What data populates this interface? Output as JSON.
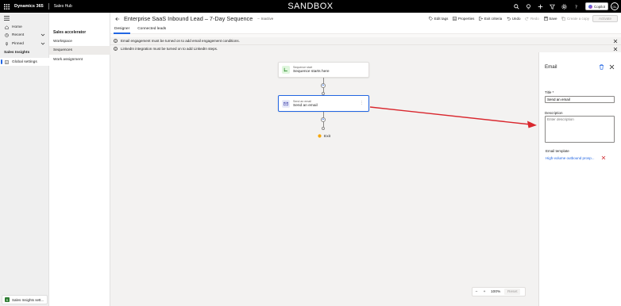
{
  "topbar": {
    "brand": "Dynamics 365",
    "app_name": "Sales Hub",
    "environment_banner": "SANDBOX",
    "copilot_label": "Copilot",
    "avatar_initials": "GL"
  },
  "leftnav": {
    "items": [
      {
        "label": "Home",
        "icon": "home-icon"
      },
      {
        "label": "Recent",
        "icon": "clock-icon"
      },
      {
        "label": "Pinned",
        "icon": "pin-icon"
      }
    ],
    "section_title": "Sales Insights",
    "active_item": "Global settings",
    "area_switcher": {
      "badge": "S",
      "label": "Sales Insights sett..."
    }
  },
  "settings": {
    "title": "Sales accelerator",
    "items": [
      "Workspace",
      "Sequences",
      "Work assignment"
    ],
    "active": "Sequences"
  },
  "header": {
    "title": "Enterprise SaaS Inbound Lead – 7-Day Sequence",
    "status": "Inactive",
    "actions": [
      {
        "label": "Edit tags",
        "icon": "tag-icon",
        "disabled": false
      },
      {
        "label": "Properties",
        "icon": "properties-icon",
        "disabled": false
      },
      {
        "label": "Exit criteria",
        "icon": "exit-icon",
        "disabled": false
      },
      {
        "label": "Undo",
        "icon": "undo-icon",
        "disabled": false
      },
      {
        "label": "Redo",
        "icon": "redo-icon",
        "disabled": true
      },
      {
        "label": "Save",
        "icon": "save-icon",
        "disabled": false
      },
      {
        "label": "Create a copy",
        "icon": "copy-icon",
        "disabled": true
      }
    ],
    "activate_label": "Activate"
  },
  "tabs": [
    {
      "label": "Designer",
      "active": true
    },
    {
      "label": "Connected leads",
      "active": false
    }
  ],
  "notifications": [
    "Email engagement must be turned on to add email engagement conditions.",
    "LinkedIn integration must be turned on to add LinkedIn steps."
  ],
  "canvas": {
    "start_node": {
      "type": "Sequence start",
      "name": "Sequence starts here"
    },
    "email_node": {
      "type": "Send an email",
      "name": "Send an email"
    },
    "exit_label": "Exit",
    "zoom_level": "100%",
    "reset_label": "Reset"
  },
  "panel": {
    "title": "Email",
    "title_label": "Title *",
    "title_value": "Send an email",
    "description_label": "Description",
    "description_placeholder": "Enter description",
    "template_label": "Email template",
    "template_value": "High-volume outbound prosp..."
  },
  "colors": {
    "accent": "#2266e3",
    "annotation_arrow": "#d9272e"
  }
}
